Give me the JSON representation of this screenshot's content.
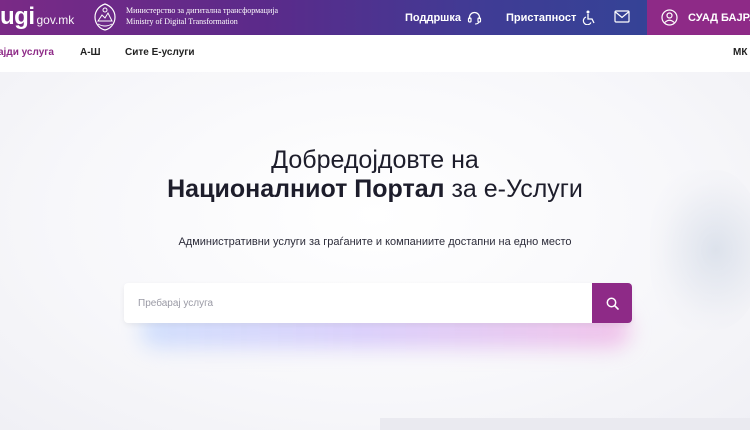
{
  "header": {
    "logo_main": "ugi",
    "logo_domain": "gov.mk",
    "ministry_line1": "Министерство за дигитална трансформација",
    "ministry_line2": "Ministry of Digital Transformation",
    "support_label": "Поддршка",
    "accessibility_label": "Пристапност",
    "user_name": "СУАД БАЈРАМ"
  },
  "subnav": {
    "items": [
      {
        "label": "ајди услуга",
        "active": true
      },
      {
        "label": "А-Ш",
        "active": false
      },
      {
        "label": "Сите Е-услуги",
        "active": false
      }
    ],
    "language": "МК"
  },
  "hero": {
    "title_line1": "Добредојдовте на",
    "title_bold": "Националниот Портал",
    "title_rest": " за е-Услуги",
    "subtitle": "Административни услуги за граѓаните и компаниите достапни на едно место"
  },
  "search": {
    "placeholder": "Пребарај услуга",
    "value": ""
  },
  "colors": {
    "brand_purple": "#8e2a87",
    "header_gradient_start": "#7a2a86",
    "header_gradient_end": "#2e4796"
  }
}
